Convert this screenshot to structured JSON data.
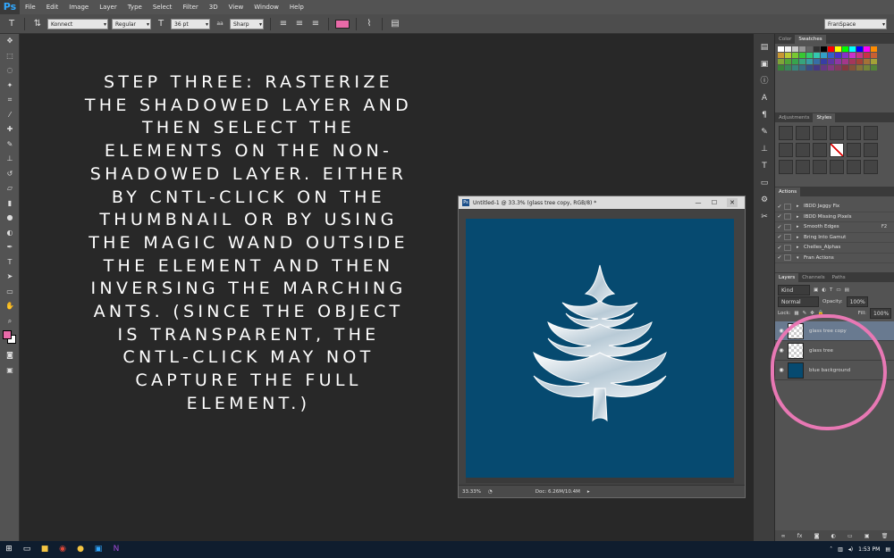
{
  "app": {
    "logo": "Ps"
  },
  "menubar": [
    "File",
    "Edit",
    "Image",
    "Layer",
    "Type",
    "Select",
    "Filter",
    "3D",
    "View",
    "Window",
    "Help"
  ],
  "options_bar": {
    "tool_icon": "type-tool-icon",
    "font_family": "Konnect",
    "font_style": "Regular",
    "font_size": "36 pt",
    "antialias": "Sharp",
    "text_color": "#e86aa8",
    "workspace": "FranSpace",
    "aa_label": "aa",
    "tt_label": "T"
  },
  "toolbox": {
    "tools": [
      "move",
      "marquee",
      "lasso",
      "quick-select",
      "crop",
      "eyedropper",
      "healing",
      "brush",
      "clone-stamp",
      "history-brush",
      "eraser",
      "gradient",
      "blur",
      "dodge",
      "pen",
      "type",
      "path-select",
      "shape",
      "hand",
      "zoom"
    ],
    "foreground_color": "#e86aa8",
    "background_color": "#ffffff"
  },
  "instructions": {
    "text": "Step three: Rasterize the shadowed layer and then select the elements on the non-shadowed layer. Either by cntl-click on the thumbnail or by using the magic wand outside the element and then inversing the marching ants. (Since the object is transparent, the cntl-click may not capture the full element.)"
  },
  "document": {
    "title": "Untitled-1 @ 33.3% (glass tree copy, RGB/8) *",
    "icon_label": "Ps",
    "zoom": "33.33%",
    "doc_size": "Doc: 6.26M/10.4M",
    "canvas_color": "#064a70"
  },
  "panels": {
    "color_tabs": [
      "Color",
      "Swatches"
    ],
    "active_color_tab": "Swatches",
    "style_tabs": [
      "Adjustments",
      "Styles"
    ],
    "actions_tab": "Actions",
    "actions": [
      {
        "label": "IBDD Jaggy Fix",
        "key": ""
      },
      {
        "label": "IBDD Missing Pixels",
        "key": ""
      },
      {
        "label": "Smooth Edges",
        "key": "F2"
      },
      {
        "label": "Bring Into Gamut",
        "key": ""
      },
      {
        "label": "Chelles_Alphas",
        "key": ""
      },
      {
        "label": "Fran Actions",
        "key": ""
      }
    ],
    "layers_tabs": [
      "Layers",
      "Channels",
      "Paths"
    ],
    "kind_label": "Kind",
    "blend_mode": "Normal",
    "opacity_label": "Opacity:",
    "opacity_value": "100%",
    "lock_label": "Lock:",
    "fill_label": "Fill:",
    "fill_value": "100%",
    "layers": [
      {
        "name": "glass tree copy",
        "selected": true
      },
      {
        "name": "glass tree",
        "selected": false
      },
      {
        "name": "blue background",
        "selected": false
      }
    ],
    "highlight_color": "#e878b4"
  },
  "taskbar": {
    "time": "1:53 PM"
  }
}
